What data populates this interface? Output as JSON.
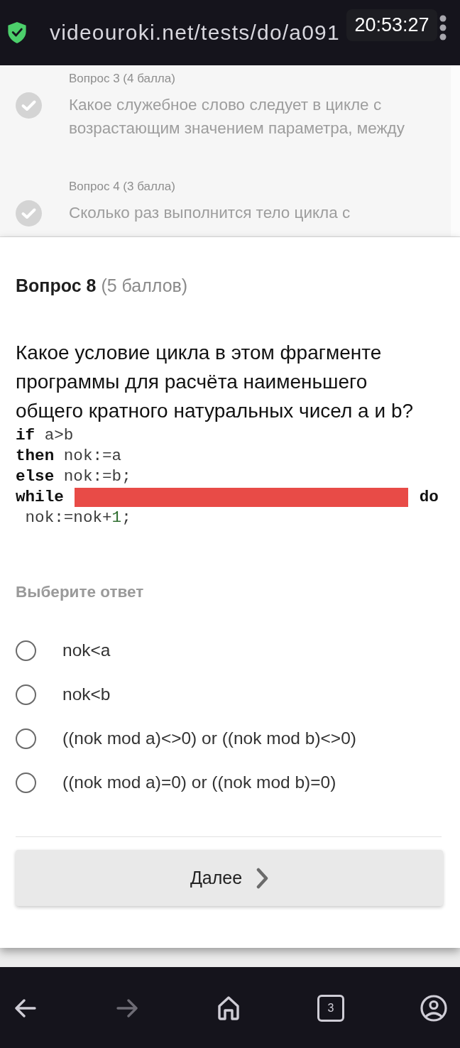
{
  "browser_bar": {
    "url": "videouroki.net/tests/do/a091",
    "secure": true
  },
  "clock_overlay": "20:53:27",
  "question_list": [
    {
      "label": "Вопрос 3 (4 балла)",
      "text": "Какое служебное слово следует в цикле с возрастающим значением параметра, между",
      "answered": true
    },
    {
      "label": "Вопрос 4 (3 балла)",
      "text": "Сколько раз выполнится тело цикла с",
      "answered": true
    }
  ],
  "question": {
    "title": "Вопрос 8",
    "points": "(5 баллов)",
    "text": "Какое условие цикла в этом фрагменте программы для расчёта наименьшего общего кратного натуральных чисел a и b?",
    "code": [
      [
        {
          "kind": "keyword",
          "text": "if"
        },
        {
          "kind": "plain",
          "text": " a>b"
        }
      ],
      [
        {
          "kind": "keyword",
          "text": "then"
        },
        {
          "kind": "plain",
          "text": " nok:=a"
        }
      ],
      [
        {
          "kind": "keyword",
          "text": "else"
        },
        {
          "kind": "plain",
          "text": " nok:=b;"
        }
      ],
      [
        {
          "kind": "keyword",
          "text": "while"
        },
        {
          "kind": "blank"
        },
        {
          "kind": "keyword",
          "text": "do"
        }
      ],
      [
        {
          "kind": "plain",
          "text": " nok:=nok+"
        },
        {
          "kind": "number",
          "text": "1"
        },
        {
          "kind": "plain",
          "text": ";"
        }
      ]
    ],
    "prompt": "Выберите ответ",
    "options": [
      {
        "label": "nok<a",
        "selected": false
      },
      {
        "label": "nok<b",
        "selected": false
      },
      {
        "label": "((nok mod a)<>0) or ((nok mod b)<>0)",
        "selected": false
      },
      {
        "label": "((nok mod a)=0) or ((nok mod b)=0)",
        "selected": false
      }
    ]
  },
  "next_button": "Далее",
  "nav_bar": [
    {
      "kind": "back",
      "disabled": false
    },
    {
      "kind": "forward",
      "disabled": true
    },
    {
      "kind": "home",
      "disabled": false
    },
    {
      "kind": "tabs",
      "count": "3",
      "disabled": false
    },
    {
      "kind": "account",
      "disabled": false
    }
  ]
}
